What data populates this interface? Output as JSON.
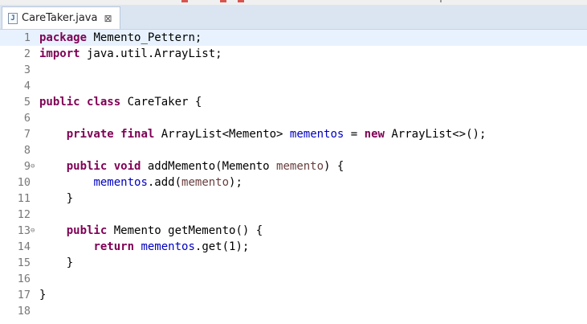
{
  "editor_tab": {
    "title": "CareTaker.java",
    "icon": "java-file-icon",
    "close_icon": "close-icon"
  },
  "colors": {
    "keyword": "#7f0055",
    "field": "#0000c0",
    "parameter": "#6a3e3e",
    "line_highlight": "#e8f2fe",
    "line_number": "#787878"
  },
  "code": {
    "lines": [
      {
        "n": "1",
        "tokens": [
          {
            "t": "package",
            "k": "kw"
          },
          {
            "t": " Memento_Pettern;"
          }
        ]
      },
      {
        "n": "2",
        "tokens": [
          {
            "t": "import",
            "k": "kw"
          },
          {
            "t": " java.util.ArrayList;"
          }
        ]
      },
      {
        "n": "3",
        "tokens": []
      },
      {
        "n": "4",
        "tokens": []
      },
      {
        "n": "5",
        "tokens": [
          {
            "t": "public",
            "k": "kw"
          },
          {
            "t": " "
          },
          {
            "t": "class",
            "k": "kw"
          },
          {
            "t": " CareTaker {"
          }
        ]
      },
      {
        "n": "6",
        "tokens": []
      },
      {
        "n": "7",
        "tokens": [
          {
            "t": "    "
          },
          {
            "t": "private",
            "k": "kw"
          },
          {
            "t": " "
          },
          {
            "t": "final",
            "k": "kw"
          },
          {
            "t": " ArrayList<Memento> "
          },
          {
            "t": "mementos",
            "k": "fld"
          },
          {
            "t": " = "
          },
          {
            "t": "new",
            "k": "kw"
          },
          {
            "t": " ArrayList<>();"
          }
        ]
      },
      {
        "n": "8",
        "tokens": []
      },
      {
        "n": "9",
        "fold": "⊖",
        "tokens": [
          {
            "t": "    "
          },
          {
            "t": "public",
            "k": "kw"
          },
          {
            "t": " "
          },
          {
            "t": "void",
            "k": "kw"
          },
          {
            "t": " addMemento(Memento "
          },
          {
            "t": "memento",
            "k": "param"
          },
          {
            "t": ") {"
          }
        ]
      },
      {
        "n": "10",
        "tokens": [
          {
            "t": "        "
          },
          {
            "t": "mementos",
            "k": "fld"
          },
          {
            "t": ".add("
          },
          {
            "t": "memento",
            "k": "param"
          },
          {
            "t": ");"
          }
        ]
      },
      {
        "n": "11",
        "tokens": [
          {
            "t": "    }"
          }
        ]
      },
      {
        "n": "12",
        "tokens": []
      },
      {
        "n": "13",
        "fold": "⊖",
        "tokens": [
          {
            "t": "    "
          },
          {
            "t": "public",
            "k": "kw"
          },
          {
            "t": " Memento getMemento() {"
          }
        ]
      },
      {
        "n": "14",
        "tokens": [
          {
            "t": "        "
          },
          {
            "t": "return",
            "k": "kw"
          },
          {
            "t": " "
          },
          {
            "t": "mementos",
            "k": "fld"
          },
          {
            "t": ".get(1);"
          }
        ]
      },
      {
        "n": "15",
        "tokens": [
          {
            "t": "    }"
          }
        ]
      },
      {
        "n": "16",
        "tokens": []
      },
      {
        "n": "17",
        "tokens": [
          {
            "t": "}"
          }
        ]
      },
      {
        "n": "18",
        "tokens": []
      }
    ]
  }
}
